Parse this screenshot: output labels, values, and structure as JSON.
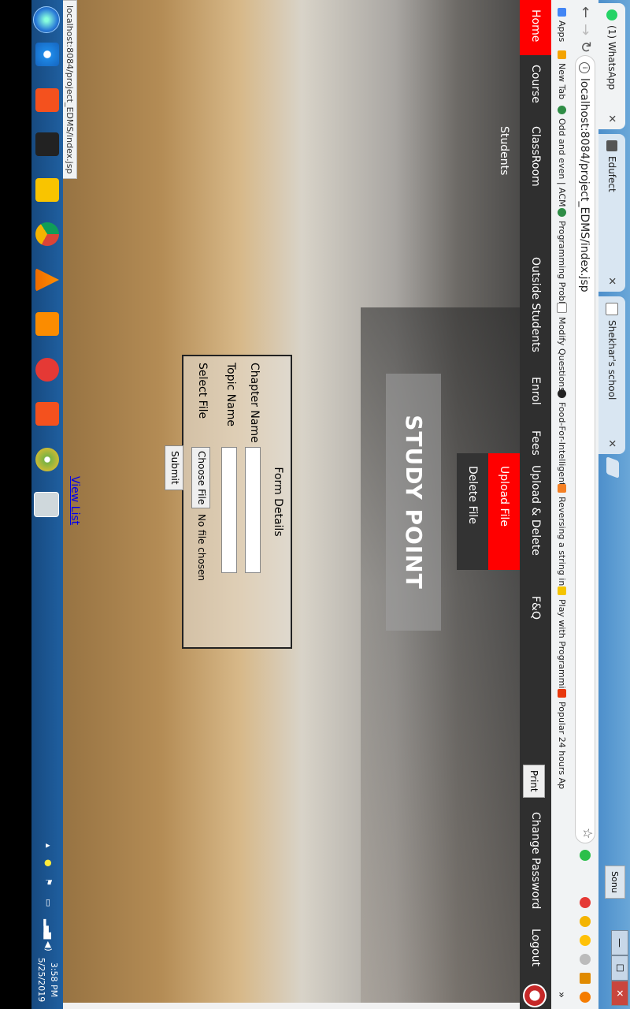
{
  "browser": {
    "tabs": [
      {
        "label": "(1) WhatsApp",
        "icon": "whatsapp-icon",
        "color": "#25d366"
      },
      {
        "label": "Edufect",
        "icon": "edufect-icon",
        "color": "#555555"
      },
      {
        "label": "Shekhar's school",
        "icon": "page-icon",
        "color": "#777777"
      }
    ],
    "profile_label": "Sonu",
    "url": "localhost:8084/project_EDMS/index.jsp",
    "bookmarks": [
      {
        "label": "Apps",
        "color": "#4285f4"
      },
      {
        "label": "New Tab",
        "color": "#f4a300"
      },
      {
        "label": "Odd and even | ACM",
        "color": "#2f8d46"
      },
      {
        "label": "Programming Proble",
        "color": "#2f8d46"
      },
      {
        "label": "Modify Questions",
        "color": "#888888"
      },
      {
        "label": "Food-For-Intelligent",
        "color": "#222222"
      },
      {
        "label": "Reversing a string in",
        "color": "#f48024"
      },
      {
        "label": "Play with Programmi",
        "color": "#f4c400"
      },
      {
        "label": "Popular 24 hours Ap",
        "color": "#e8380d"
      }
    ],
    "more_bookmarks": "»"
  },
  "site": {
    "nav": [
      {
        "label": "Home",
        "active": true
      },
      {
        "label": "Course"
      },
      {
        "label": "ClassRoom Students"
      },
      {
        "label": "Outside Students"
      },
      {
        "label": "Enrol"
      },
      {
        "label": "Fees"
      },
      {
        "label": "Upload & Delete File"
      },
      {
        "label": "F&Q"
      }
    ],
    "dropdown": [
      {
        "label": "Upload File",
        "active": true
      },
      {
        "label": "Delete File"
      }
    ],
    "print_label": "Print",
    "change_password": "Change Password",
    "logout": "Logout",
    "title": "STUDY POINT",
    "form": {
      "title": "Form Details",
      "chapter_label": "Chapter Name",
      "topic_label": "Topic Name",
      "file_label": "Select File",
      "choose_file": "Choose File",
      "no_file": "No file chosen",
      "submit": "Submit"
    },
    "view_list": "View List"
  },
  "status_url": "localhost:8084/project_EDMS/index.jsp",
  "taskbar": {
    "time": "3:58 PM",
    "date": "5/25/2019"
  },
  "colors": {
    "nav_active": "#ff0000",
    "navbar": "#2f2f2f",
    "link": "#0000ee"
  }
}
